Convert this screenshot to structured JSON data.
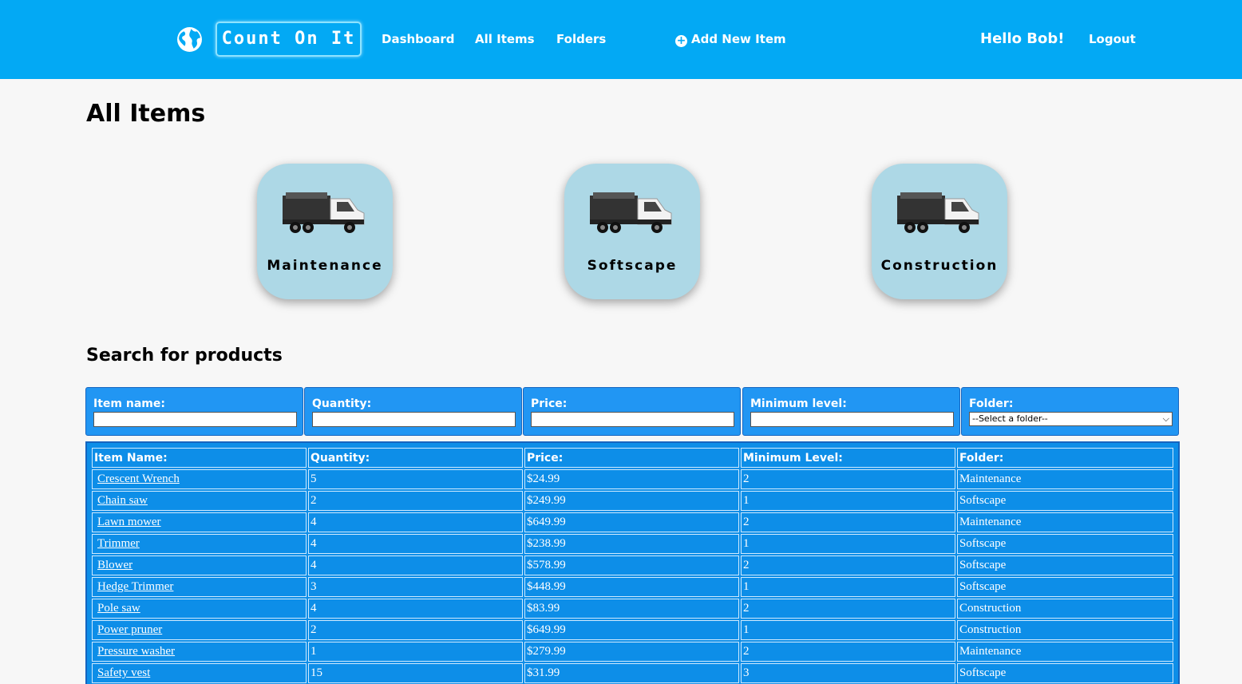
{
  "nav": {
    "brand": "Count On It",
    "links": [
      "Dashboard",
      "All Items",
      "Folders"
    ],
    "add_item": "Add New Item",
    "greeting": "Hello Bob!",
    "logout": "Logout",
    "globe_icon": "globe-icon"
  },
  "page": {
    "title": "All Items",
    "folders": [
      "Maintenance",
      "Softscape",
      "Construction"
    ],
    "search_title": "Search for products"
  },
  "filters": {
    "item_name": "Item name:",
    "quantity": "Quantity:",
    "price": "Price:",
    "minimum_level": "Minimum level:",
    "folder": "Folder:",
    "folder_select": "--Select a folder--"
  },
  "table": {
    "headers": [
      "Item Name:",
      "Quantity:",
      "Price:",
      "Minimum Level:",
      "Folder:"
    ],
    "rows": [
      [
        "Crescent Wrench",
        "5",
        "$24.99",
        "2",
        "Maintenance"
      ],
      [
        "Chain saw",
        "2",
        "$249.99",
        "1",
        "Softscape"
      ],
      [
        "Lawn mower",
        "4",
        "$649.99",
        "2",
        "Maintenance"
      ],
      [
        "Trimmer",
        "4",
        "$238.99",
        "1",
        "Softscape"
      ],
      [
        "Blower",
        "4",
        "$578.99",
        "2",
        "Softscape"
      ],
      [
        "Hedge Trimmer",
        "3",
        "$448.99",
        "1",
        "Softscape"
      ],
      [
        "Pole saw",
        "4",
        "$83.99",
        "2",
        "Construction"
      ],
      [
        "Power pruner",
        "2",
        "$649.99",
        "1",
        "Construction"
      ],
      [
        "Pressure washer",
        "1",
        "$279.99",
        "2",
        "Maintenance"
      ],
      [
        "Safety vest",
        "15",
        "$31.99",
        "3",
        "Softscape"
      ]
    ]
  },
  "colors": {
    "navbar": "#03a9f4",
    "card": "#add8e6",
    "table": "#0d8ee8"
  }
}
